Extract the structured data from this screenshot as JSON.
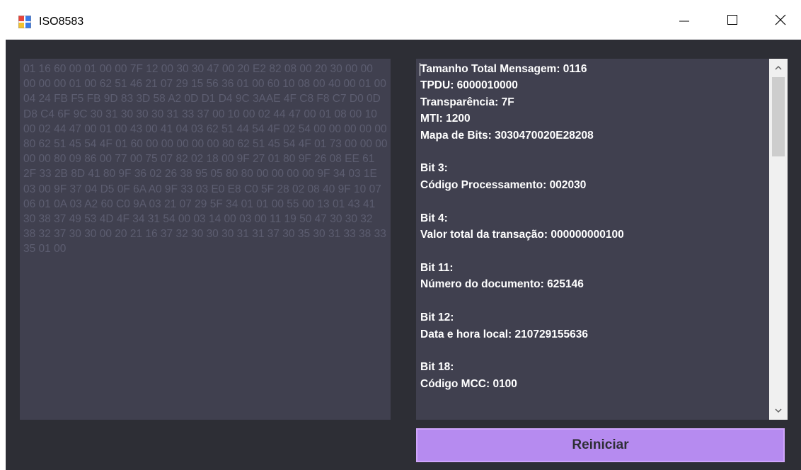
{
  "window": {
    "title": "ISO8583",
    "icon": "app-window-icon"
  },
  "colors": {
    "client_background": "#2d2e35",
    "panel_background": "#40404f",
    "hex_text": "#5c5d70",
    "info_text": "#ffffff",
    "button_background": "#b68bf0"
  },
  "hex_panel": {
    "text": "01 16 60 00 01 00 00 7F 12 00 30 30 47 00 20 E2 82 08 00 20 30 00 00 00 00 00 01 00 62 51 46 21 07 29 15 56 36 01 00 60 10 08 00 40 00 01 00 04 24 FB F5 FB 9D 83 3D 58 A2 0D D1 D4 9C 3AAE 4F C8 F8 C7 D0 0D D8 C4 6F 9C 30 31 30 30 30 31 33 37 00 10 00 02 44 47 00 01 08 00 10 00 02 44 47 00 01 00 43 00 41 04 03 62 51 44 54 4F 02 54 00 00 00 00 00 80 62 51 45 54 4F 01 60 00 00 00 00 00 80 62 51 45 54 4F 01 73 00 00 00 00 00 80 09 86 00 77 00 75 07 82 02 18 00 9F 27 01 80 9F 26 08 EE 61 2F 33 2B 8D 41 80 9F 36 02 26 38 95 05 80 80 00 00 00 00 9F 34 03 1E 03 00 9F 37 04 D5 0F 6A A0 9F 33 03 E0 E8 C0 5F 28 02 08 40 9F 10 07 06 01 0A 03 A2 60 C0 9A 03 21 07 29 5F 34 01 01 00 55 00 13 01 43 41 30 38 37 49 53 4D 4F 34 31 54 00 03 14 00 03 00 11 19 50 47 30 30 32 38 32 37 30 30 00 20 21 16 37 32 30 30 30 31 31 37 30 35 30 31 33 38 33 35 01 00"
  },
  "info_panel": {
    "text": "Tamanho Total Mensagem: 0116\nTPDU: 6000010000\nTransparência: 7F\nMTI: 1200\nMapa de Bits: 3030470020E28208\n\nBit 3:\nCódigo Processamento: 002030\n\nBit 4:\nValor total da transação: 000000000100\n\nBit 11:\nNúmero do documento: 625146\n\nBit 12:\nData e hora local: 210729155636\n\nBit 18:\nCódigo MCC: 0100"
  },
  "restart_button": {
    "label": "Reiniciar"
  }
}
